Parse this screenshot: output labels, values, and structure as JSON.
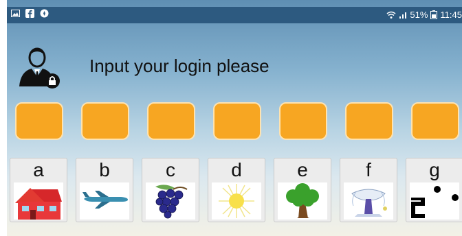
{
  "status_bar": {
    "signal_text": "51%",
    "time": "11:45",
    "icons": [
      "image-icon",
      "facebook-icon",
      "compass-icon",
      "wifi-icon",
      "signal-icon",
      "battery-icon"
    ]
  },
  "header": {
    "title": "Input your login please",
    "icon": "user-lock-icon"
  },
  "login_slots": {
    "count": 7,
    "color": "#f7a622"
  },
  "letters": [
    {
      "letter": "a",
      "image": "house"
    },
    {
      "letter": "b",
      "image": "airplane"
    },
    {
      "letter": "c",
      "image": "grapes"
    },
    {
      "letter": "d",
      "image": "sun"
    },
    {
      "letter": "e",
      "image": "tree"
    },
    {
      "letter": "f",
      "image": "fountain"
    },
    {
      "letter": "g",
      "image": "dominoes"
    }
  ]
}
